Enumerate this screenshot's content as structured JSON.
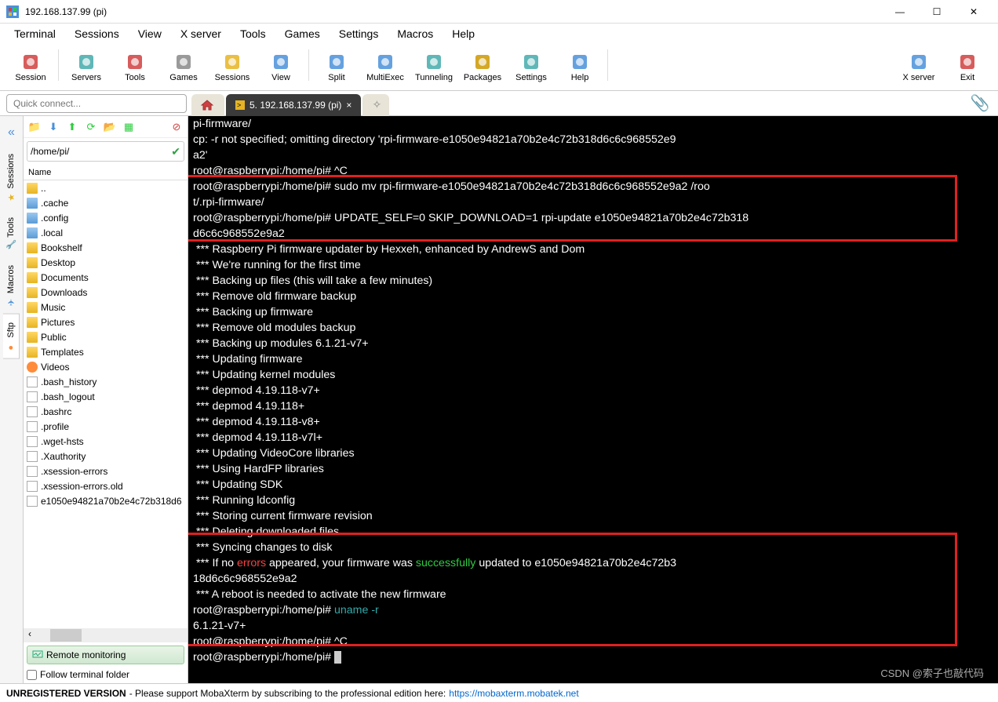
{
  "window": {
    "title": "192.168.137.99 (pi)"
  },
  "menubar": [
    "Terminal",
    "Sessions",
    "View",
    "X server",
    "Tools",
    "Games",
    "Settings",
    "Macros",
    "Help"
  ],
  "toolbar": [
    {
      "label": "Session",
      "color": "#d04040"
    },
    {
      "label": "Servers",
      "color": "#4aa"
    },
    {
      "label": "Tools",
      "color": "#d04040"
    },
    {
      "label": "Games",
      "color": "#888"
    },
    {
      "label": "Sessions",
      "color": "#e6b422"
    },
    {
      "label": "View",
      "color": "#4a90d9"
    },
    {
      "label": "Split",
      "color": "#4a90d9"
    },
    {
      "label": "MultiExec",
      "color": "#4a90d9"
    },
    {
      "label": "Tunneling",
      "color": "#4aa"
    },
    {
      "label": "Packages",
      "color": "#c90"
    },
    {
      "label": "Settings",
      "color": "#4aa"
    },
    {
      "label": "Help",
      "color": "#4a90d9"
    }
  ],
  "toolbar_right": [
    {
      "label": "X server",
      "color": "#4a90d9"
    },
    {
      "label": "Exit",
      "color": "#d04040"
    }
  ],
  "quick_connect_placeholder": "Quick connect...",
  "tabs": {
    "active_label": "5. 192.168.137.99 (pi)"
  },
  "side_tabs": [
    "Sessions",
    "Tools",
    "Macros",
    "Sftp"
  ],
  "sftp": {
    "path": "/home/pi/",
    "header": "Name",
    "items": [
      {
        "name": "..",
        "icon": "folder"
      },
      {
        "name": ".cache",
        "icon": "folder-blue"
      },
      {
        "name": ".config",
        "icon": "folder-blue"
      },
      {
        "name": ".local",
        "icon": "folder-blue"
      },
      {
        "name": "Bookshelf",
        "icon": "folder"
      },
      {
        "name": "Desktop",
        "icon": "folder"
      },
      {
        "name": "Documents",
        "icon": "folder"
      },
      {
        "name": "Downloads",
        "icon": "folder"
      },
      {
        "name": "Music",
        "icon": "folder"
      },
      {
        "name": "Pictures",
        "icon": "folder"
      },
      {
        "name": "Public",
        "icon": "folder"
      },
      {
        "name": "Templates",
        "icon": "folder"
      },
      {
        "name": "Videos",
        "icon": "orange"
      },
      {
        "name": ".bash_history",
        "icon": "file"
      },
      {
        "name": ".bash_logout",
        "icon": "file"
      },
      {
        "name": ".bashrc",
        "icon": "file"
      },
      {
        "name": ".profile",
        "icon": "file"
      },
      {
        "name": ".wget-hsts",
        "icon": "file"
      },
      {
        "name": ".Xauthority",
        "icon": "file"
      },
      {
        "name": ".xsession-errors",
        "icon": "file"
      },
      {
        "name": ".xsession-errors.old",
        "icon": "file"
      },
      {
        "name": "e1050e94821a70b2e4c72b318d6",
        "icon": "file"
      }
    ],
    "remote_monitoring": "Remote monitoring",
    "follow_label": "Follow terminal folder"
  },
  "terminal": {
    "lines": [
      {
        "t": "pi-firmware/"
      },
      {
        "t": "cp: -r not specified; omitting directory 'rpi-firmware-e1050e94821a70b2e4c72b318d6c6c968552e9"
      },
      {
        "t": "a2'"
      },
      {
        "t": "root@raspberrypi:/home/pi# ^C"
      },
      {
        "t": "root@raspberrypi:/home/pi# sudo mv rpi-firmware-e1050e94821a70b2e4c72b318d6c6c968552e9a2 /roo"
      },
      {
        "t": "t/.rpi-firmware/"
      },
      {
        "t": "root@raspberrypi:/home/pi# UPDATE_SELF=0 SKIP_DOWNLOAD=1 rpi-update e1050e94821a70b2e4c72b318"
      },
      {
        "t": "d6c6c968552e9a2"
      },
      {
        "t": " *** Raspberry Pi firmware updater by Hexxeh, enhanced by AndrewS and Dom"
      },
      {
        "t": " *** We're running for the first time"
      },
      {
        "t": " *** Backing up files (this will take a few minutes)"
      },
      {
        "t": " *** Remove old firmware backup"
      },
      {
        "t": " *** Backing up firmware"
      },
      {
        "t": " *** Remove old modules backup"
      },
      {
        "t": " *** Backing up modules 6.1.21-v7+"
      },
      {
        "t": " *** Updating firmware"
      },
      {
        "t": " *** Updating kernel modules"
      },
      {
        "t": " *** depmod 4.19.118-v7+"
      },
      {
        "t": " *** depmod 4.19.118+"
      },
      {
        "t": " *** depmod 4.19.118-v8+"
      },
      {
        "t": " *** depmod 4.19.118-v7l+"
      },
      {
        "t": " *** Updating VideoCore libraries"
      },
      {
        "t": " *** Using HardFP libraries"
      },
      {
        "t": " *** Updating SDK"
      },
      {
        "t": " *** Running ldconfig"
      },
      {
        "t": " *** Storing current firmware revision"
      },
      {
        "t": " *** Deleting downloaded files"
      },
      {
        "t": " *** Syncing changes to disk"
      },
      {
        "html": " *** If no <span class='c-red'>errors</span> appeared, your firmware was <span class='c-green'>successfully</span> updated to e1050e94821a70b2e4c72b3"
      },
      {
        "t": "18d6c6c968552e9a2"
      },
      {
        "t": " *** A reboot is needed to activate the new firmware"
      },
      {
        "html": "root@raspberrypi:/home/pi# <span class='c-teal'>uname -r</span>"
      },
      {
        "t": "6.1.21-v7+"
      },
      {
        "t": "root@raspberrypi:/home/pi# ^C"
      },
      {
        "html": "root@raspberrypi:/home/pi# <span class='cursor-block'></span>"
      }
    ]
  },
  "statusbar": {
    "unreg": "UNREGISTERED VERSION",
    "msg": " -  Please support MobaXterm by subscribing to the professional edition here:  ",
    "link": "https://mobaxterm.mobatek.net"
  },
  "watermark": "CSDN @索子也敲代码"
}
